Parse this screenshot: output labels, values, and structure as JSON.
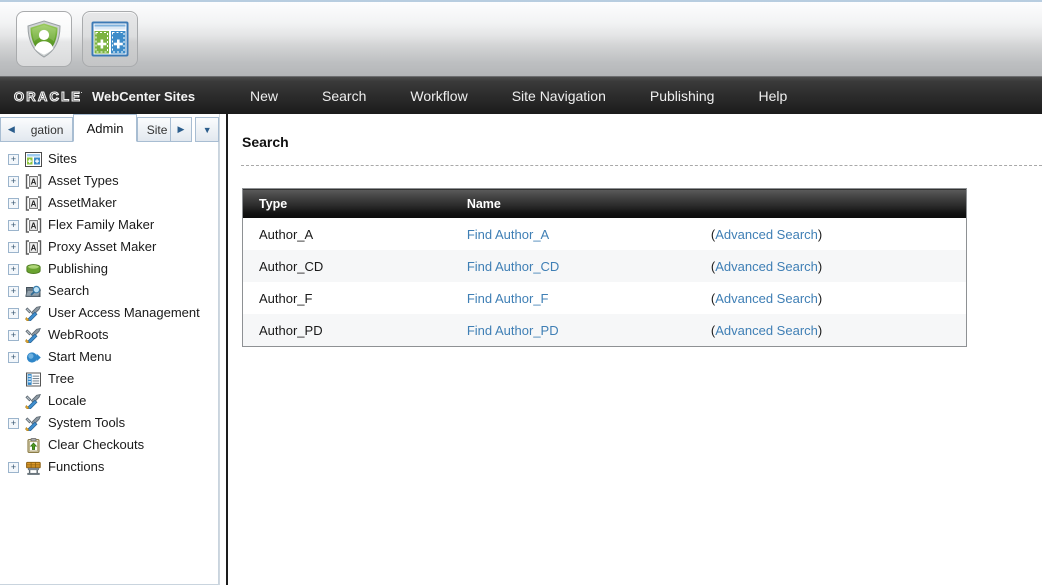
{
  "window": {
    "title": "Oracle WebCenter Sites"
  },
  "toolbar": {
    "buttons": [
      {
        "name": "security-shield-icon",
        "label": ""
      },
      {
        "name": "split-window-icon",
        "label": ""
      }
    ]
  },
  "brand": {
    "oracle": "ORACLE",
    "registered": "·",
    "product": "WebCenter Sites"
  },
  "menu": {
    "items": [
      {
        "label": "New"
      },
      {
        "label": "Search"
      },
      {
        "label": "Workflow"
      },
      {
        "label": "Site Navigation"
      },
      {
        "label": "Publishing"
      },
      {
        "label": "Help"
      }
    ]
  },
  "tabs": {
    "prev_arrow": "◀",
    "next_arrow": "▶",
    "dropdown_arrow": "▼",
    "items": [
      {
        "label": "gation",
        "active": false
      },
      {
        "label": "Admin",
        "active": true
      },
      {
        "label": "Site",
        "active": false
      }
    ]
  },
  "sidebar": {
    "items": [
      {
        "label": "Sites",
        "expandable": true,
        "icon": "sites-icon"
      },
      {
        "label": "Asset Types",
        "expandable": true,
        "icon": "asset-type-icon"
      },
      {
        "label": "AssetMaker",
        "expandable": true,
        "icon": "asset-type-icon"
      },
      {
        "label": "Flex Family Maker",
        "expandable": true,
        "icon": "asset-type-icon"
      },
      {
        "label": "Proxy Asset Maker",
        "expandable": true,
        "icon": "asset-type-icon"
      },
      {
        "label": "Publishing",
        "expandable": true,
        "icon": "publishing-icon"
      },
      {
        "label": "Search",
        "expandable": true,
        "icon": "search-icon"
      },
      {
        "label": "User Access Management",
        "expandable": true,
        "icon": "tools-icon"
      },
      {
        "label": "WebRoots",
        "expandable": true,
        "icon": "tools-icon"
      },
      {
        "label": "Start Menu",
        "expandable": true,
        "icon": "start-menu-icon"
      },
      {
        "label": "Tree",
        "expandable": false,
        "icon": "tree-icon"
      },
      {
        "label": "Locale",
        "expandable": false,
        "icon": "tools-icon"
      },
      {
        "label": "System Tools",
        "expandable": true,
        "icon": "tools-icon"
      },
      {
        "label": "Clear Checkouts",
        "expandable": false,
        "icon": "clipboard-icon"
      },
      {
        "label": "Functions",
        "expandable": true,
        "icon": "functions-icon"
      }
    ],
    "expander_plus": "+"
  },
  "main": {
    "page_title": "Search",
    "table": {
      "headers": [
        "Type",
        "Name",
        ""
      ],
      "rows": [
        {
          "type": "Author_A",
          "find_label": "Find Author_A",
          "adv_open": "(",
          "adv_label": "Advanced Search",
          "adv_close": ")"
        },
        {
          "type": "Author_CD",
          "find_label": "Find Author_CD",
          "adv_open": "(",
          "adv_label": "Advanced Search",
          "adv_close": ")"
        },
        {
          "type": "Author_F",
          "find_label": "Find Author_F",
          "adv_open": "(",
          "adv_label": "Advanced Search",
          "adv_close": ")"
        },
        {
          "type": "Author_PD",
          "find_label": "Find Author_PD",
          "adv_open": "(",
          "adv_label": "Advanced Search",
          "adv_close": ")"
        }
      ]
    }
  },
  "colors": {
    "link": "#3f7fb5",
    "header_dark": "#1b1b1b",
    "row_alt": "#f6f7f8",
    "tab_border": "#a8bdd2"
  }
}
